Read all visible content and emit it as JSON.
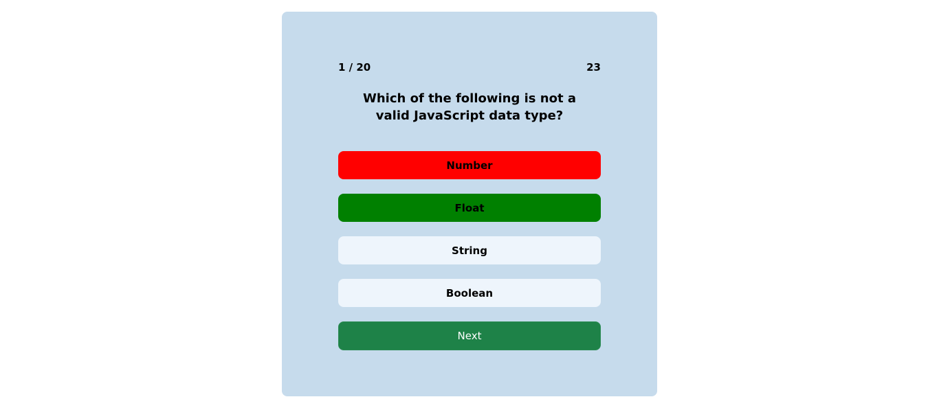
{
  "quiz": {
    "progress": "1 / 20",
    "timer": "23",
    "question": "Which of the following is not a valid JavaScript data type?",
    "options": [
      {
        "label": "Number",
        "state": "incorrect",
        "color": "#ff0000"
      },
      {
        "label": "Float",
        "state": "correct",
        "color": "#008000"
      },
      {
        "label": "String",
        "state": "neutral",
        "color": "#eef5fc"
      },
      {
        "label": "Boolean",
        "state": "neutral",
        "color": "#eef5fc"
      }
    ],
    "next_label": "Next"
  },
  "colors": {
    "page_bg": "#ffffff",
    "card_bg": "#c6dbec",
    "next_bg": "#1e8248"
  }
}
